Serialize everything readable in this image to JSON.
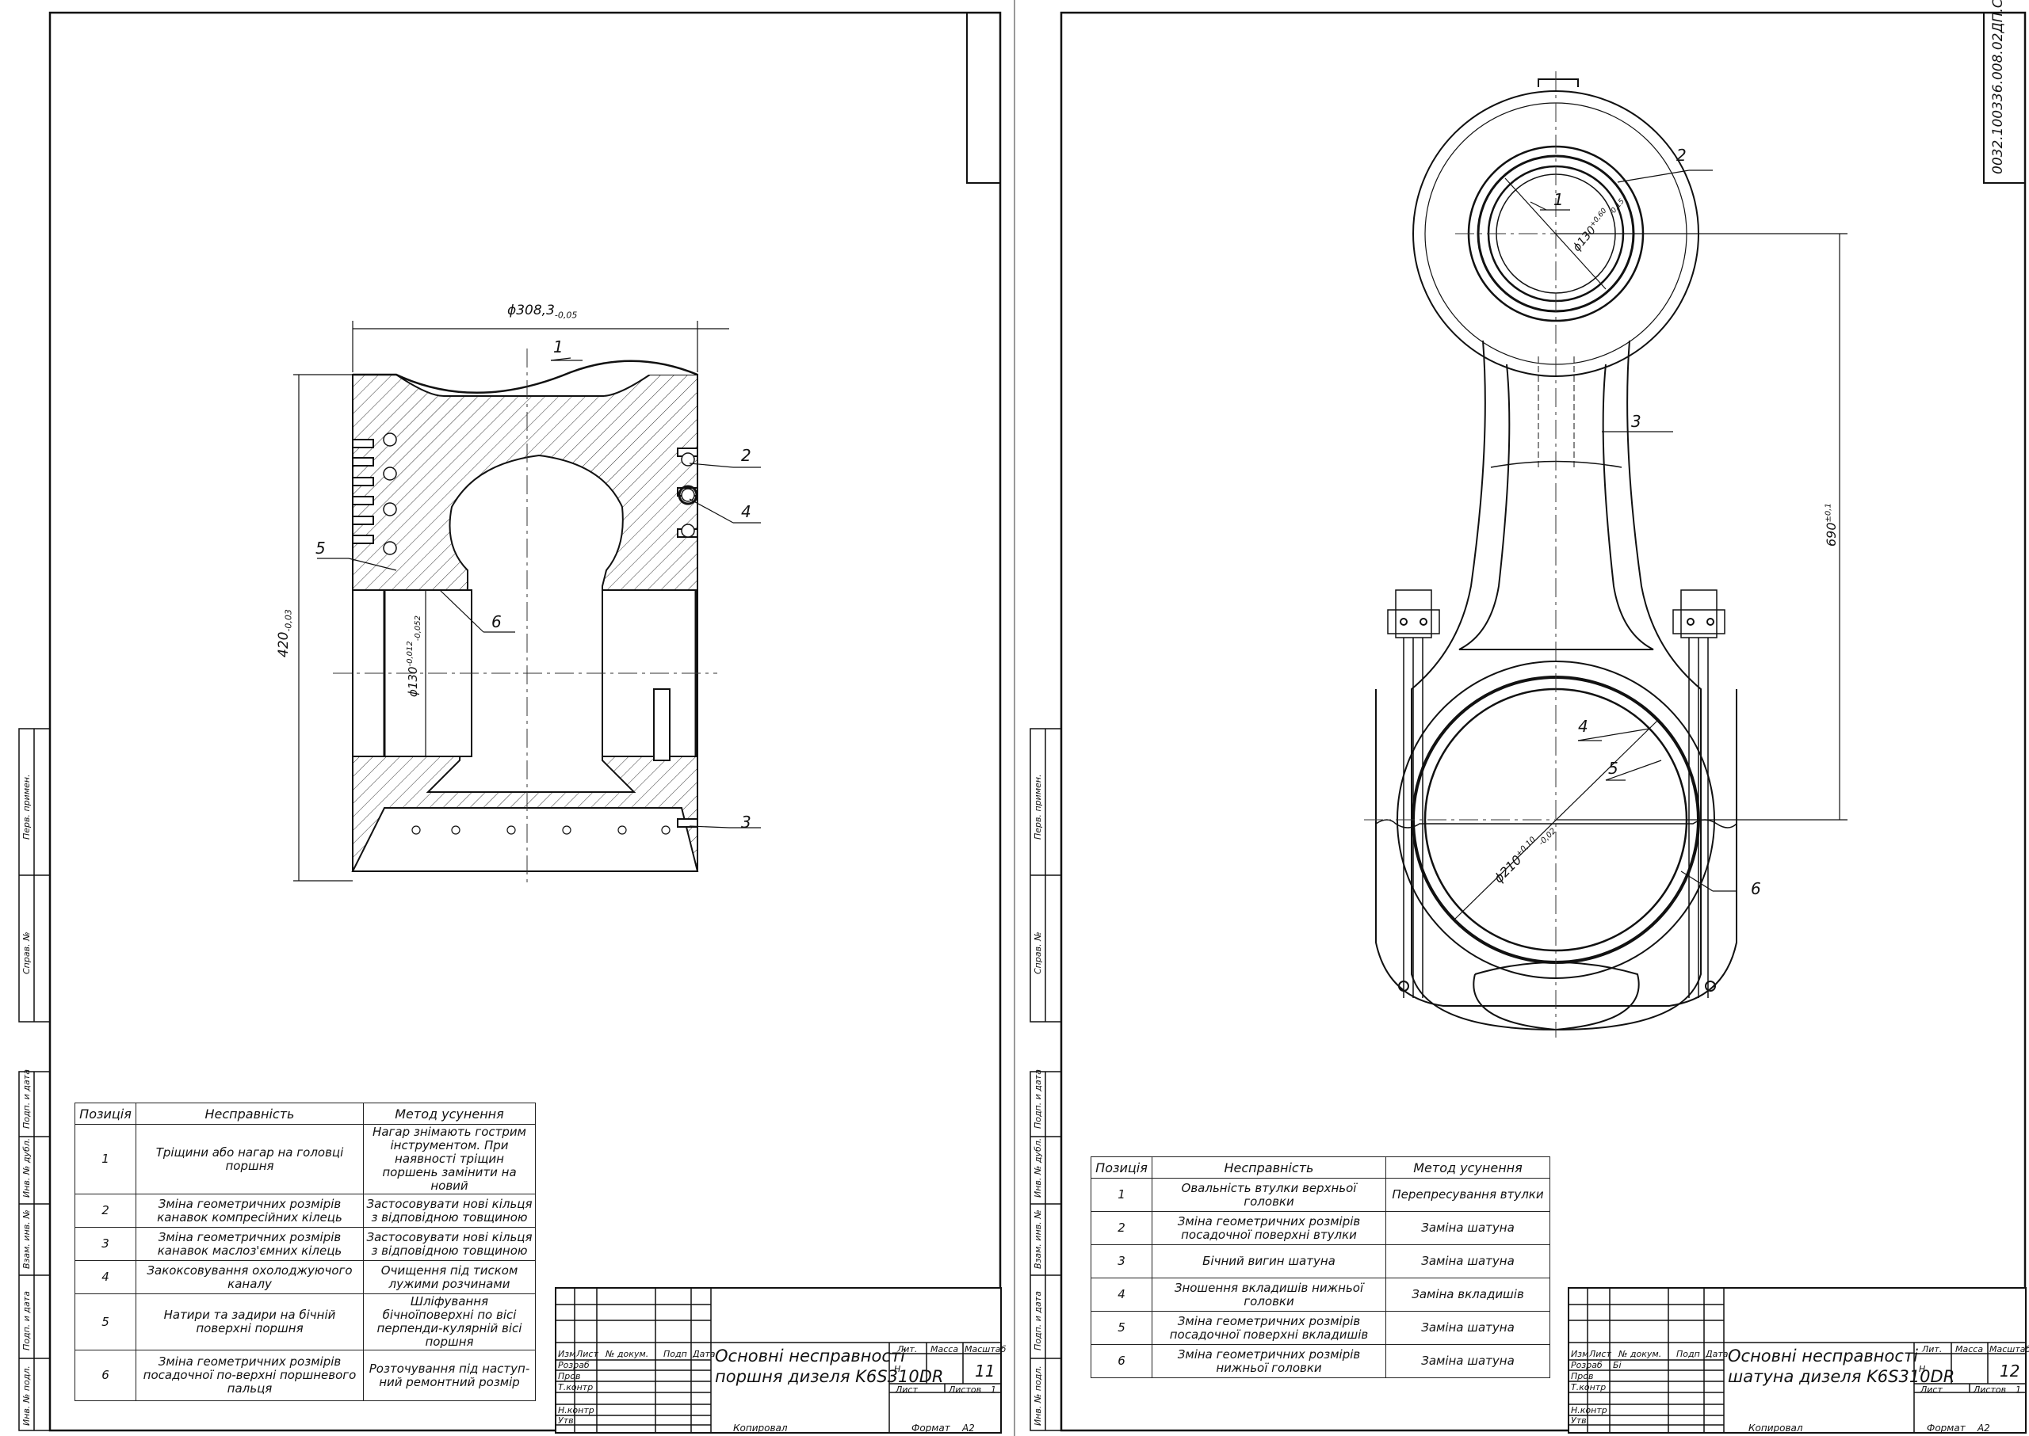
{
  "left_sheet": {
    "dims": {
      "diameter": "ϕ308,3",
      "diameter_tol": "-0,05",
      "height": "420",
      "height_tol": "-0,03",
      "pin": "ϕ130",
      "pin_tol_up": "-0,012",
      "pin_tol_low": "-0,052"
    },
    "callouts": [
      "1",
      "2",
      "3",
      "4",
      "5",
      "6"
    ],
    "table": {
      "headers": [
        "Позиція",
        "Несправність",
        "Метод усунення"
      ],
      "rows": [
        {
          "pos": "1",
          "fault": "Тріщини або нагар на головці поршня",
          "method": "Нагар знімають гострим інструментом. При наявності тріщин поршень замінити на новий"
        },
        {
          "pos": "2",
          "fault": "Зміна геометричних розмірів канавок компресійних кілець",
          "method": "Застосовувати нові кільця з відповідною товщиною"
        },
        {
          "pos": "3",
          "fault": "Зміна геометричних розмірів канавок маслоз'ємних кілець",
          "method": "Застосовувати нові кільця з відповідною товщиною"
        },
        {
          "pos": "4",
          "fault": "Закоксовування охолоджуючого каналу",
          "method": "Очищення під тиском лужими розчинами"
        },
        {
          "pos": "5",
          "fault": "Натири та задири на бічній поверхні поршня",
          "method": "Шліфування бічноїповерхні по вісі перпенди-кулярній вісі поршня"
        },
        {
          "pos": "6",
          "fault": "Зміна геометричних розмірів посадочної по-верхні поршневого пальця",
          "method": "Розточування під наступ-ний ремонтний розмір"
        }
      ]
    },
    "title_block": {
      "title_line1": "Основні несправності",
      "title_line2": "поршня дизеля K6S310DR",
      "sheet_number": "11",
      "lit_value": "Н",
      "labels": {
        "izm": "Изм",
        "list": "Лист",
        "docnum": "№ докум.",
        "podp": "Подп",
        "data": "Дата",
        "razrab": "Розраб",
        "prov": "Пров",
        "tkontr": "Т.контр",
        "nkontr": "Н.контр",
        "utv": "Утв",
        "lit": "Лит.",
        "massa": "Масса",
        "masshtab": "Масштаб",
        "list2": "Лист",
        "listov": "Листов",
        "listov_val": "1"
      }
    },
    "footer": {
      "copied": "Копировал",
      "format": "Формат",
      "format_val": "А2"
    }
  },
  "right_sheet": {
    "doc_id": "0032.100336.008.02ДП.СХ",
    "dims": {
      "upper_bore": "ϕ130",
      "upper_tol_up": "+0,60",
      "upper_tol_low": "-0,15",
      "center_dist": "690",
      "center_tol": "±0,1",
      "lower_bore": "ϕ210",
      "lower_tol_up": "+0,10",
      "lower_tol_low": "-0,02"
    },
    "callouts": [
      "1",
      "2",
      "3",
      "4",
      "5",
      "6"
    ],
    "table": {
      "headers": [
        "Позиція",
        "Несправність",
        "Метод усунення"
      ],
      "rows": [
        {
          "pos": "1",
          "fault": "Овальність втулки верхньої головки",
          "method": "Перепресування втулки"
        },
        {
          "pos": "2",
          "fault": "Зміна геометричних розмірів посадочної поверхні втулки",
          "method": "Заміна шатуна"
        },
        {
          "pos": "3",
          "fault": "Бічний вигин шатуна",
          "method": "Заміна шатуна"
        },
        {
          "pos": "4",
          "fault": "Зношення вкладишів нижньої головки",
          "method": "Заміна вкладишів"
        },
        {
          "pos": "5",
          "fault": "Зміна геометричних розмірів посадочної поверхні вкладишів",
          "method": "Заміна шатуна"
        },
        {
          "pos": "6",
          "fault": "Зміна геометричних розмірів нижньої головки",
          "method": "Заміна шатуна"
        }
      ]
    },
    "title_block": {
      "title_line1": "Основні несправності",
      "title_line2": "шатуна дизеля K6S310DR",
      "sheet_number": "12",
      "lit_value": "Н",
      "razrab_name": "Бі",
      "labels": {
        "izm": "Изм",
        "list": "Лист",
        "docnum": "№ докум.",
        "podp": "Подп",
        "data": "Дата",
        "razrab": "Розраб",
        "prov": "Пров",
        "tkontr": "Т.контр",
        "nkontr": "Н.контр",
        "utv": "Утв",
        "lit": "Лит.",
        "massa": "Масса",
        "masshtab": "Масштаб",
        "list2": "Лист",
        "listov": "Листов",
        "listov_val": "1"
      }
    },
    "footer": {
      "copied": "Копировал",
      "format": "Формат",
      "format_val": "А2"
    }
  },
  "side_stamp_labels": [
    "Перв. примен.",
    "Справ. №",
    "Подп. и дата",
    "Инв. № дубл.",
    "Взам. инв. №",
    "Подп. и дата",
    "Инв. № подл."
  ]
}
